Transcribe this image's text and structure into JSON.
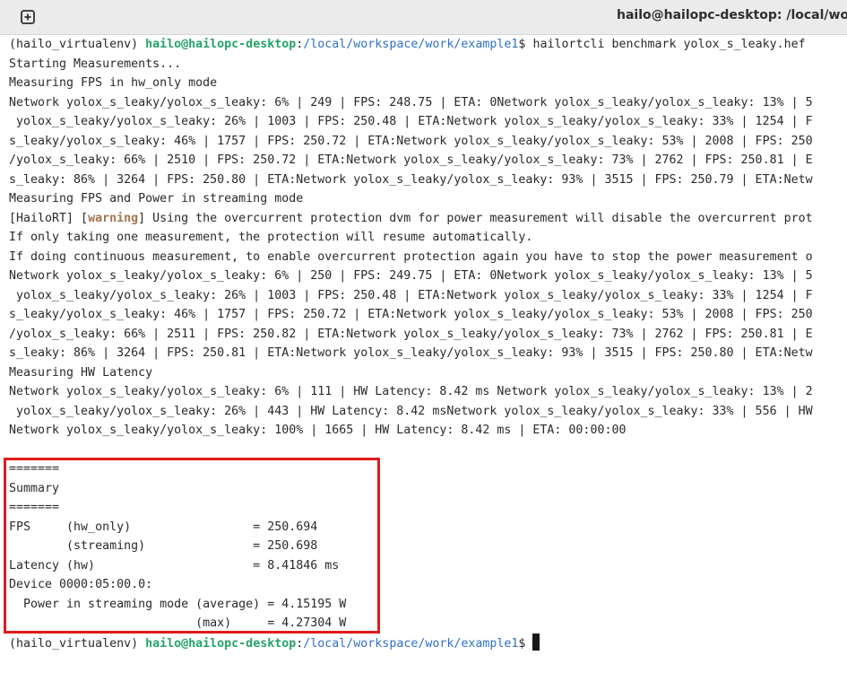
{
  "titlebar": {
    "new_tab_icon": "new-tab-icon",
    "title": "hailo@hailopc-desktop: /local/wor"
  },
  "colors": {
    "prompt_user": "#26a269",
    "prompt_path": "#3070c8",
    "warning": "#a2734c",
    "highlight_box": "#e01b1b"
  },
  "prompt1": {
    "env": "(hailo_virtualenv) ",
    "user_host": "hailo@hailopc-desktop",
    "colon": ":",
    "path": "/local/workspace/work/example1",
    "symbol": "$ ",
    "command": "hailortcli benchmark yolox_s_leaky.hef"
  },
  "output": {
    "line1": "Starting Measurements...",
    "line2": "Measuring FPS in hw_only mode",
    "line3": "Network yolox_s_leaky/yolox_s_leaky: 6% | 249 | FPS: 248.75 | ETA: 0Network yolox_s_leaky/yolox_s_leaky: 13% | 5",
    "line4": " yolox_s_leaky/yolox_s_leaky: 26% | 1003 | FPS: 250.48 | ETA:Network yolox_s_leaky/yolox_s_leaky: 33% | 1254 | F",
    "line5": "s_leaky/yolox_s_leaky: 46% | 1757 | FPS: 250.72 | ETA:Network yolox_s_leaky/yolox_s_leaky: 53% | 2008 | FPS: 250",
    "line6": "/yolox_s_leaky: 66% | 2510 | FPS: 250.72 | ETA:Network yolox_s_leaky/yolox_s_leaky: 73% | 2762 | FPS: 250.81 | E",
    "line7": "s_leaky: 86% | 3264 | FPS: 250.80 | ETA:Network yolox_s_leaky/yolox_s_leaky: 93% | 3515 | FPS: 250.79 | ETA:Netw",
    "line8": "Measuring FPS and Power in streaming mode",
    "line9_prefix": "[HailoRT] [",
    "line9_warning": "warning",
    "line9_suffix": "] Using the overcurrent protection dvm for power measurement will disable the overcurrent prot",
    "line10": "If only taking one measurement, the protection will resume automatically.",
    "line11": "If doing continuous measurement, to enable overcurrent protection again you have to stop the power measurement o",
    "line12": "Network yolox_s_leaky/yolox_s_leaky: 6% | 250 | FPS: 249.75 | ETA: 0Network yolox_s_leaky/yolox_s_leaky: 13% | 5",
    "line13": " yolox_s_leaky/yolox_s_leaky: 26% | 1003 | FPS: 250.48 | ETA:Network yolox_s_leaky/yolox_s_leaky: 33% | 1254 | F",
    "line14": "s_leaky/yolox_s_leaky: 46% | 1757 | FPS: 250.72 | ETA:Network yolox_s_leaky/yolox_s_leaky: 53% | 2008 | FPS: 250",
    "line15": "/yolox_s_leaky: 66% | 2511 | FPS: 250.82 | ETA:Network yolox_s_leaky/yolox_s_leaky: 73% | 2762 | FPS: 250.81 | E",
    "line16": "s_leaky: 86% | 3264 | FPS: 250.81 | ETA:Network yolox_s_leaky/yolox_s_leaky: 93% | 3515 | FPS: 250.80 | ETA:Netw",
    "line17": "Measuring HW Latency",
    "line18": "Network yolox_s_leaky/yolox_s_leaky: 6% | 111 | HW Latency: 8.42 ms Network yolox_s_leaky/yolox_s_leaky: 13% | 2",
    "line19": " yolox_s_leaky/yolox_s_leaky: 26% | 443 | HW Latency: 8.42 msNetwork yolox_s_leaky/yolox_s_leaky: 33% | 556 | HW",
    "line20": "Network yolox_s_leaky/yolox_s_leaky: 100% | 1665 | HW Latency: 8.42 ms | ETA: 00:00:00"
  },
  "summary": {
    "sep1": "=======",
    "title": "Summary",
    "sep2": "=======",
    "fps_hw": "FPS     (hw_only)                 = 250.694",
    "fps_stream": "        (streaming)               = 250.698",
    "latency": "Latency (hw)                      = 8.41846 ms",
    "device": "Device 0000:05:00.0:",
    "power_avg": "  Power in streaming mode (average) = 4.15195 W",
    "power_max": "                          (max)     = 4.27304 W"
  },
  "prompt2": {
    "env": "(hailo_virtualenv) ",
    "user_host": "hailo@hailopc-desktop",
    "colon": ":",
    "path": "/local/workspace/work/example1",
    "symbol": "$"
  }
}
